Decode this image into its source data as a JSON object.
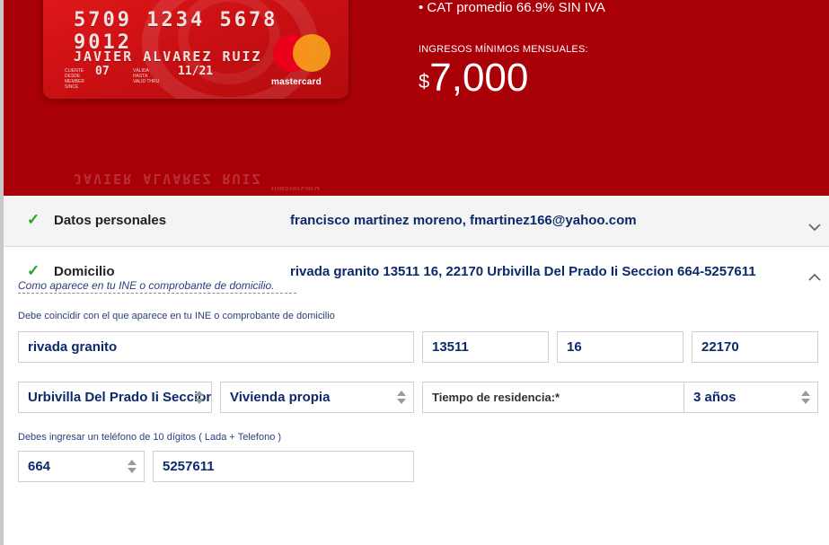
{
  "card": {
    "number": "5709 1234 5678 9012",
    "holder": "JAVIER ALVAREZ RUIZ",
    "member_since_label": "CLIENTE DESDE MEMBER SINCE",
    "member_since": "07",
    "valid_thru_label": "VÁLIDA HASTA VALID THRU",
    "valid_thru": "11/21",
    "brand": "mastercard"
  },
  "offer": {
    "cat": "• CAT promedio 66.9% SIN IVA",
    "income_label": "INGRESOS MÍNIMOS MENSUALES:",
    "currency": "$",
    "income": "7,000"
  },
  "sections": {
    "personal": {
      "title": "Datos personales",
      "summary": "francisco martinez moreno, fmartinez166@yahoo.com"
    },
    "address": {
      "title": "Domicilio",
      "summary": "rivada granito 13511 16, 22170 Urbivilla Del Prado Ii Seccion 664-5257611",
      "hint": "Como aparece en tu INE o comprobante de domicilio."
    }
  },
  "form": {
    "help_address": "Debe coincidir con el que aparece en tu INE o comprobante de domicilio",
    "street": "rivada granito",
    "ext_number": "13511",
    "int_number": "16",
    "zip": "22170",
    "colonia": "Urbivilla Del Prado Ii Seccion",
    "housing_type": "Vivienda propia",
    "residence_label": "Tiempo de residencia:*",
    "residence_time": "3 años",
    "help_phone": "Debes ingresar un teléfono de 10 dígitos ( Lada + Telefono )",
    "lada": "664",
    "phone": "5257611"
  },
  "colors": {
    "hero_bg": "#a90007",
    "check": "#22a622",
    "value_text": "#0c2a6b"
  }
}
